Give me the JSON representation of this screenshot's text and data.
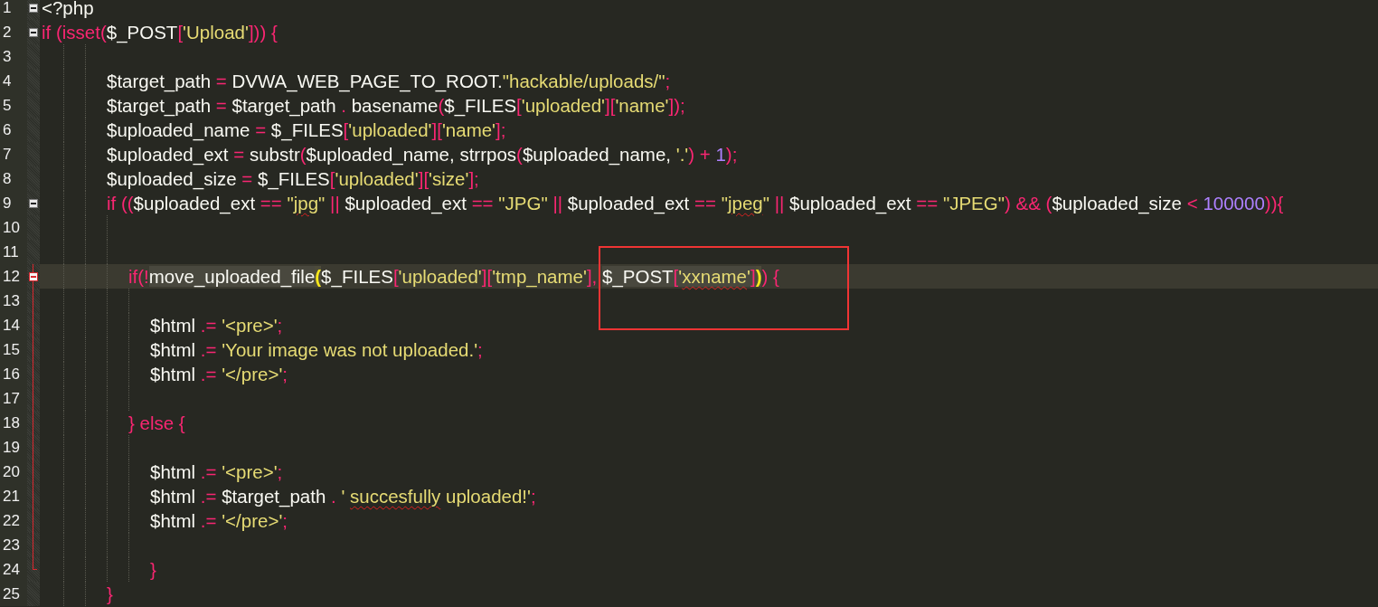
{
  "editor": {
    "annotation_box": true,
    "lines": [
      {
        "number": "1",
        "fold": true,
        "current": false,
        "in_fold": false,
        "tokens": [
          {
            "text": "<?php",
            "kind": "plain"
          }
        ]
      },
      {
        "number": "2",
        "fold": true,
        "current": false,
        "in_fold": false,
        "tokens": [
          {
            "text": "if (isset(",
            "kind": "keyword"
          },
          {
            "text": "$_POST",
            "kind": "plain"
          },
          {
            "text": "[",
            "kind": "keyword"
          },
          {
            "text": "'Upload'",
            "kind": "string"
          },
          {
            "text": "])) {",
            "kind": "keyword"
          }
        ]
      },
      {
        "number": "3",
        "fold": false,
        "current": false,
        "in_fold": false
      },
      {
        "number": "4",
        "fold": false,
        "current": false,
        "in_fold": false,
        "tokens": [
          {
            "text": "\t\t\t$target_path",
            "kind": "plain"
          },
          {
            "text": " = ",
            "kind": "keyword"
          },
          {
            "text": "DVWA_WEB_PAGE_TO_ROOT.",
            "kind": "plain"
          },
          {
            "text": "\"hackable/uploads/\"",
            "kind": "string"
          },
          {
            "text": ";",
            "kind": "keyword"
          }
        ]
      },
      {
        "number": "5",
        "fold": false,
        "current": false,
        "in_fold": false,
        "tokens": [
          {
            "text": "\t\t\t$target_path",
            "kind": "plain"
          },
          {
            "text": " = ",
            "kind": "keyword"
          },
          {
            "text": "$target_path",
            "kind": "plain"
          },
          {
            "text": " . ",
            "kind": "keyword"
          },
          {
            "text": "basename",
            "kind": "plain"
          },
          {
            "text": "(",
            "kind": "keyword"
          },
          {
            "text": "$_FILES",
            "kind": "plain"
          },
          {
            "text": "[",
            "kind": "keyword"
          },
          {
            "text": "'uploaded'",
            "kind": "string"
          },
          {
            "text": "][",
            "kind": "keyword"
          },
          {
            "text": "'name'",
            "kind": "string"
          },
          {
            "text": "]);",
            "kind": "keyword"
          }
        ]
      },
      {
        "number": "6",
        "fold": false,
        "current": false,
        "in_fold": false,
        "tokens": [
          {
            "text": "\t\t\t$uploaded_name",
            "kind": "plain"
          },
          {
            "text": " = ",
            "kind": "keyword"
          },
          {
            "text": "$_FILES",
            "kind": "plain"
          },
          {
            "text": "[",
            "kind": "keyword"
          },
          {
            "text": "'uploaded'",
            "kind": "string"
          },
          {
            "text": "][",
            "kind": "keyword"
          },
          {
            "text": "'name'",
            "kind": "string"
          },
          {
            "text": "];",
            "kind": "keyword"
          }
        ]
      },
      {
        "number": "7",
        "fold": false,
        "current": false,
        "in_fold": false,
        "tokens": [
          {
            "text": "\t\t\t$uploaded_ext",
            "kind": "plain"
          },
          {
            "text": " = ",
            "kind": "keyword"
          },
          {
            "text": "substr",
            "kind": "plain"
          },
          {
            "text": "(",
            "kind": "keyword"
          },
          {
            "text": "$uploaded_name, strrpos",
            "kind": "plain"
          },
          {
            "text": "(",
            "kind": "keyword"
          },
          {
            "text": "$uploaded_name, ",
            "kind": "plain"
          },
          {
            "text": "'.'",
            "kind": "string"
          },
          {
            "text": ") + ",
            "kind": "keyword"
          },
          {
            "text": "1",
            "kind": "number"
          },
          {
            "text": ");",
            "kind": "keyword"
          }
        ]
      },
      {
        "number": "8",
        "fold": false,
        "current": false,
        "in_fold": false,
        "tokens": [
          {
            "text": "\t\t\t$uploaded_size",
            "kind": "plain"
          },
          {
            "text": " = ",
            "kind": "keyword"
          },
          {
            "text": "$_FILES",
            "kind": "plain"
          },
          {
            "text": "[",
            "kind": "keyword"
          },
          {
            "text": "'uploaded'",
            "kind": "string"
          },
          {
            "text": "][",
            "kind": "keyword"
          },
          {
            "text": "'size'",
            "kind": "string"
          },
          {
            "text": "];",
            "kind": "keyword"
          }
        ]
      },
      {
        "number": "9",
        "fold": true,
        "current": false,
        "in_fold": false,
        "tokens": [
          {
            "text": "\t\t\tif ((",
            "kind": "keyword"
          },
          {
            "text": "$uploaded_ext",
            "kind": "plain"
          },
          {
            "text": " == ",
            "kind": "keyword"
          },
          {
            "text": "\"",
            "kind": "string"
          },
          {
            "text": "jpg",
            "kind": "string",
            "squiggle": true
          },
          {
            "text": "\"",
            "kind": "string"
          },
          {
            "text": " || ",
            "kind": "keyword"
          },
          {
            "text": "$uploaded_ext",
            "kind": "plain"
          },
          {
            "text": " == ",
            "kind": "keyword"
          },
          {
            "text": "\"JPG\"",
            "kind": "string"
          },
          {
            "text": " || ",
            "kind": "keyword"
          },
          {
            "text": "$uploaded_ext",
            "kind": "plain"
          },
          {
            "text": " == ",
            "kind": "keyword"
          },
          {
            "text": "\"",
            "kind": "string"
          },
          {
            "text": "jpeg",
            "kind": "string",
            "squiggle": true
          },
          {
            "text": "\"",
            "kind": "string"
          },
          {
            "text": " || ",
            "kind": "keyword"
          },
          {
            "text": "$uploaded_ext",
            "kind": "plain"
          },
          {
            "text": " == ",
            "kind": "keyword"
          },
          {
            "text": "\"JPEG\"",
            "kind": "string"
          },
          {
            "text": ") && (",
            "kind": "keyword"
          },
          {
            "text": "$uploaded_size",
            "kind": "plain"
          },
          {
            "text": " < ",
            "kind": "keyword"
          },
          {
            "text": "100000",
            "kind": "number"
          },
          {
            "text": ")){",
            "kind": "keyword"
          }
        ]
      },
      {
        "number": "10",
        "fold": false,
        "current": false,
        "in_fold": false
      },
      {
        "number": "11",
        "fold": false,
        "current": false,
        "in_fold": false
      },
      {
        "number": "12",
        "fold": true,
        "current": true,
        "in_fold": true,
        "tokens": [
          {
            "text": "\t\t\t\tif(!",
            "kind": "keyword"
          },
          {
            "text": "move_uploaded_file",
            "kind": "plain",
            "mark": true
          },
          {
            "text": "(",
            "kind": "brace"
          },
          {
            "text": "$_FILES",
            "kind": "plain"
          },
          {
            "text": "[",
            "kind": "keyword"
          },
          {
            "text": "'uploaded'",
            "kind": "string"
          },
          {
            "text": "][",
            "kind": "keyword"
          },
          {
            "text": "'tmp_name'",
            "kind": "string"
          },
          {
            "text": "], ",
            "kind": "keyword"
          },
          {
            "text": "$_POST",
            "kind": "plain",
            "mark": true
          },
          {
            "text": "[",
            "kind": "keyword",
            "mark": true
          },
          {
            "text": "'",
            "kind": "string",
            "mark": true
          },
          {
            "text": "xxname",
            "kind": "string",
            "squiggle": true,
            "mark": true
          },
          {
            "text": "'",
            "kind": "string",
            "mark": true
          },
          {
            "text": "]",
            "kind": "keyword",
            "mark": true
          },
          {
            "text": ")",
            "kind": "brace"
          },
          {
            "text": ") {",
            "kind": "keyword"
          }
        ]
      },
      {
        "number": "13",
        "fold": false,
        "current": false,
        "in_fold": true
      },
      {
        "number": "14",
        "fold": false,
        "current": false,
        "in_fold": true,
        "tokens": [
          {
            "text": "\t\t\t\t\t$html",
            "kind": "plain"
          },
          {
            "text": " .= ",
            "kind": "keyword"
          },
          {
            "text": "'<pre>'",
            "kind": "string"
          },
          {
            "text": ";",
            "kind": "keyword"
          }
        ]
      },
      {
        "number": "15",
        "fold": false,
        "current": false,
        "in_fold": true,
        "tokens": [
          {
            "text": "\t\t\t\t\t$html",
            "kind": "plain"
          },
          {
            "text": " .= ",
            "kind": "keyword"
          },
          {
            "text": "'Your image was not uploaded.'",
            "kind": "string"
          },
          {
            "text": ";",
            "kind": "keyword"
          }
        ]
      },
      {
        "number": "16",
        "fold": false,
        "current": false,
        "in_fold": true,
        "tokens": [
          {
            "text": "\t\t\t\t\t$html",
            "kind": "plain"
          },
          {
            "text": " .= ",
            "kind": "keyword"
          },
          {
            "text": "'</pre>'",
            "kind": "string"
          },
          {
            "text": ";",
            "kind": "keyword"
          }
        ]
      },
      {
        "number": "17",
        "fold": false,
        "current": false,
        "in_fold": true
      },
      {
        "number": "18",
        "fold": false,
        "current": false,
        "in_fold": true,
        "tokens": [
          {
            "text": "\t\t\t\t} else {",
            "kind": "keyword"
          }
        ]
      },
      {
        "number": "19",
        "fold": false,
        "current": false,
        "in_fold": true
      },
      {
        "number": "20",
        "fold": false,
        "current": false,
        "in_fold": true,
        "tokens": [
          {
            "text": "\t\t\t\t\t$html",
            "kind": "plain"
          },
          {
            "text": " .= ",
            "kind": "keyword"
          },
          {
            "text": "'<pre>'",
            "kind": "string"
          },
          {
            "text": ";",
            "kind": "keyword"
          }
        ]
      },
      {
        "number": "21",
        "fold": false,
        "current": false,
        "in_fold": true,
        "tokens": [
          {
            "text": "\t\t\t\t\t$html",
            "kind": "plain"
          },
          {
            "text": " .= ",
            "kind": "keyword"
          },
          {
            "text": "$target_path",
            "kind": "plain"
          },
          {
            "text": " . ",
            "kind": "keyword"
          },
          {
            "text": "' ",
            "kind": "string"
          },
          {
            "text": "succesfully",
            "kind": "string",
            "squiggle": true
          },
          {
            "text": " uploaded!'",
            "kind": "string"
          },
          {
            "text": ";",
            "kind": "keyword"
          }
        ]
      },
      {
        "number": "22",
        "fold": false,
        "current": false,
        "in_fold": true,
        "tokens": [
          {
            "text": "\t\t\t\t\t$html",
            "kind": "plain"
          },
          {
            "text": " .= ",
            "kind": "keyword"
          },
          {
            "text": "'</pre>'",
            "kind": "string"
          },
          {
            "text": ";",
            "kind": "keyword"
          }
        ]
      },
      {
        "number": "23",
        "fold": false,
        "current": false,
        "in_fold": true
      },
      {
        "number": "24",
        "fold": false,
        "current": false,
        "in_fold": true,
        "tokens": [
          {
            "text": "\t\t\t\t\t}",
            "kind": "keyword"
          }
        ]
      },
      {
        "number": "25",
        "fold": false,
        "current": false,
        "in_fold": false,
        "tokens": [
          {
            "text": "\t\t\t}",
            "kind": "keyword"
          }
        ]
      }
    ]
  }
}
